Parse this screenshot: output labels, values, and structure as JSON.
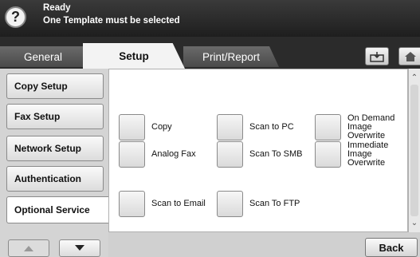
{
  "status": {
    "help_symbol": "?",
    "line1": "Ready",
    "line2": "One Template must be selected"
  },
  "tabs": [
    {
      "label": "General",
      "active": false
    },
    {
      "label": "Setup",
      "active": true
    },
    {
      "label": "Print/Report",
      "active": false
    }
  ],
  "toolbar": {
    "icons": [
      "tray-icon",
      "home-icon"
    ]
  },
  "left_menu": {
    "items": [
      {
        "label": "Copy Setup",
        "selected": false
      },
      {
        "label": "Fax Setup",
        "selected": false
      },
      {
        "label": "Network Setup",
        "selected": false
      },
      {
        "label": "Authentication",
        "selected": false
      },
      {
        "label": "Optional Service",
        "selected": true
      }
    ]
  },
  "services": {
    "items": [
      {
        "label": "Copy"
      },
      {
        "label": "Scan to PC"
      },
      {
        "label": "On Demand Image Overwrite"
      },
      {
        "label": "Analog Fax"
      },
      {
        "label": "Scan To SMB"
      },
      {
        "label": "Immediate Image Overwrite"
      },
      {
        "label": "Scan to Email"
      },
      {
        "label": "Scan To FTP"
      }
    ]
  },
  "footer": {
    "back_label": "Back"
  },
  "colors": {
    "status_bg": "#2a2a2a",
    "tab_active_bg": "#f3f3f3",
    "panel_bg": "#d4d4d4"
  }
}
